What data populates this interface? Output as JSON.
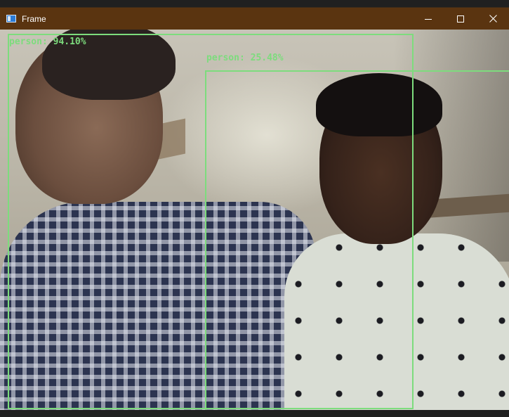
{
  "window": {
    "title": "Frame",
    "titlebar_color": "#5a3410",
    "controls": [
      {
        "name": "minimize",
        "icon": "minimize-icon"
      },
      {
        "name": "maximize",
        "icon": "maximize-icon"
      },
      {
        "name": "close",
        "icon": "close-icon"
      }
    ]
  },
  "detections": [
    {
      "label": "person: 94.10%"
    },
    {
      "label": "person: 25.48%"
    }
  ],
  "colors": {
    "bbox": "#7ddc7d"
  }
}
